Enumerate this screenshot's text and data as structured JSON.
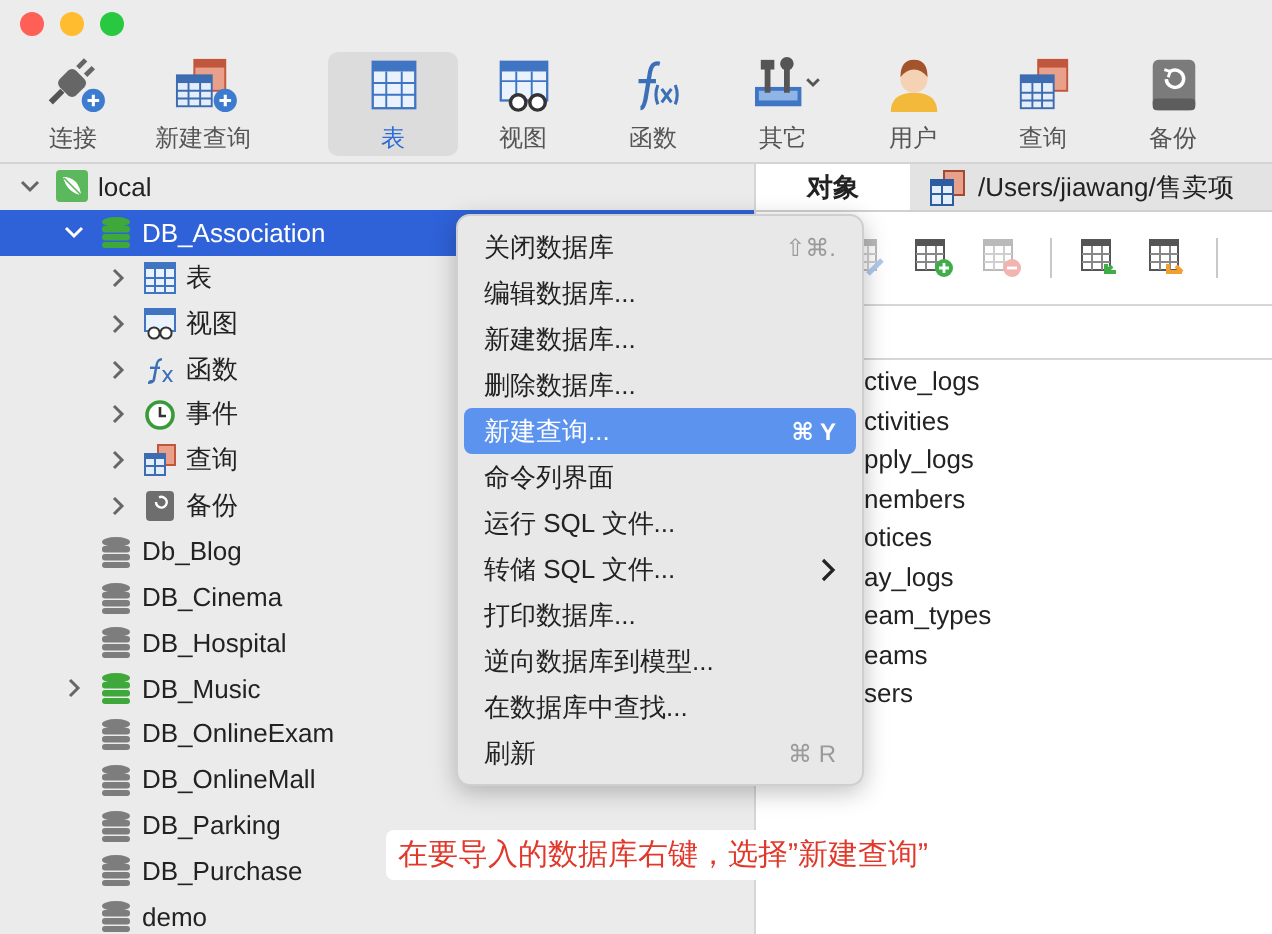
{
  "toolbar": [
    {
      "label": "连接",
      "kind": "connect",
      "selected": false
    },
    {
      "label": "新建查询",
      "kind": "new_query",
      "selected": false
    },
    {
      "label": "表",
      "kind": "table",
      "selected": true
    },
    {
      "label": "视图",
      "kind": "view",
      "selected": false
    },
    {
      "label": "函数",
      "kind": "function",
      "selected": false
    },
    {
      "label": "其它",
      "kind": "tools",
      "selected": false,
      "dropdown": true
    },
    {
      "label": "用户",
      "kind": "user",
      "selected": false
    },
    {
      "label": "查询",
      "kind": "query",
      "selected": false
    },
    {
      "label": "备份",
      "kind": "backup",
      "selected": false
    }
  ],
  "sidebar": {
    "tree": [
      {
        "label": "local",
        "kind": "connection",
        "expandable": true,
        "expanded": true,
        "selected": false,
        "children": [
          {
            "label": "DB_Association",
            "kind": "database",
            "open": true,
            "expandable": true,
            "expanded": true,
            "selected": true,
            "children": [
              {
                "label": "表",
                "kind": "tables",
                "expandable": true,
                "expanded": false,
                "selected": false
              },
              {
                "label": "视图",
                "kind": "views",
                "expandable": true,
                "expanded": false,
                "selected": false
              },
              {
                "label": "函数",
                "kind": "functions",
                "expandable": true,
                "expanded": false,
                "selected": false
              },
              {
                "label": "事件",
                "kind": "events",
                "expandable": true,
                "expanded": false,
                "selected": false
              },
              {
                "label": "查询",
                "kind": "queries",
                "expandable": true,
                "expanded": false,
                "selected": false
              },
              {
                "label": "备份",
                "kind": "backups",
                "expandable": true,
                "expanded": false,
                "selected": false
              }
            ]
          },
          {
            "label": "Db_Blog",
            "kind": "database",
            "open": false,
            "expandable": false,
            "selected": false
          },
          {
            "label": "DB_Cinema",
            "kind": "database",
            "open": false,
            "expandable": false,
            "selected": false
          },
          {
            "label": "DB_Hospital",
            "kind": "database",
            "open": false,
            "expandable": false,
            "selected": false
          },
          {
            "label": "DB_Music",
            "kind": "database",
            "open": true,
            "expandable": true,
            "expanded": false,
            "selected": false
          },
          {
            "label": "DB_OnlineExam",
            "kind": "database",
            "open": false,
            "expandable": false,
            "selected": false
          },
          {
            "label": "DB_OnlineMall",
            "kind": "database",
            "open": false,
            "expandable": false,
            "selected": false
          },
          {
            "label": "DB_Parking",
            "kind": "database",
            "open": false,
            "expandable": false,
            "selected": false
          },
          {
            "label": "DB_Purchase",
            "kind": "database",
            "open": false,
            "expandable": false,
            "selected": false
          },
          {
            "label": "demo",
            "kind": "database",
            "open": false,
            "expandable": false,
            "selected": false
          }
        ]
      }
    ]
  },
  "tabs": [
    {
      "label": "对象",
      "selected": true
    },
    {
      "label": "/Users/jiawang/售卖项",
      "selected": false
    }
  ],
  "object_toolbar": [
    {
      "kind": "edit",
      "disabled": true
    },
    {
      "kind": "add",
      "disabled": false
    },
    {
      "kind": "delete",
      "disabled": true
    },
    {
      "kind": "import",
      "disabled": false
    },
    {
      "kind": "export",
      "disabled": false
    }
  ],
  "object_list": [
    "ctive_logs",
    "ctivities",
    "pply_logs",
    "nembers",
    "otices",
    "ay_logs",
    "eam_types",
    "eams",
    "sers"
  ],
  "context_menu": [
    {
      "label": "关闭数据库",
      "shortcut": "⇧⌘.",
      "selected": false,
      "submenu": false
    },
    {
      "label": "编辑数据库...",
      "selected": false,
      "submenu": false
    },
    {
      "label": "新建数据库...",
      "selected": false,
      "submenu": false
    },
    {
      "label": "删除数据库...",
      "selected": false,
      "submenu": false
    },
    {
      "label": "新建查询...",
      "shortcut": "⌘ Y",
      "selected": true,
      "submenu": false
    },
    {
      "label": "命令列界面",
      "selected": false,
      "submenu": false
    },
    {
      "label": "运行 SQL 文件...",
      "selected": false,
      "submenu": false
    },
    {
      "label": "转储 SQL 文件...",
      "selected": false,
      "submenu": true
    },
    {
      "label": "打印数据库...",
      "selected": false,
      "submenu": false
    },
    {
      "label": "逆向数据库到模型...",
      "selected": false,
      "submenu": false
    },
    {
      "label": "在数据库中查找...",
      "selected": false,
      "submenu": false
    },
    {
      "label": "刷新",
      "shortcut": "⌘ R",
      "selected": false,
      "submenu": false
    }
  ],
  "annotation": "在要导入的数据库右键，选择”新建查询”"
}
